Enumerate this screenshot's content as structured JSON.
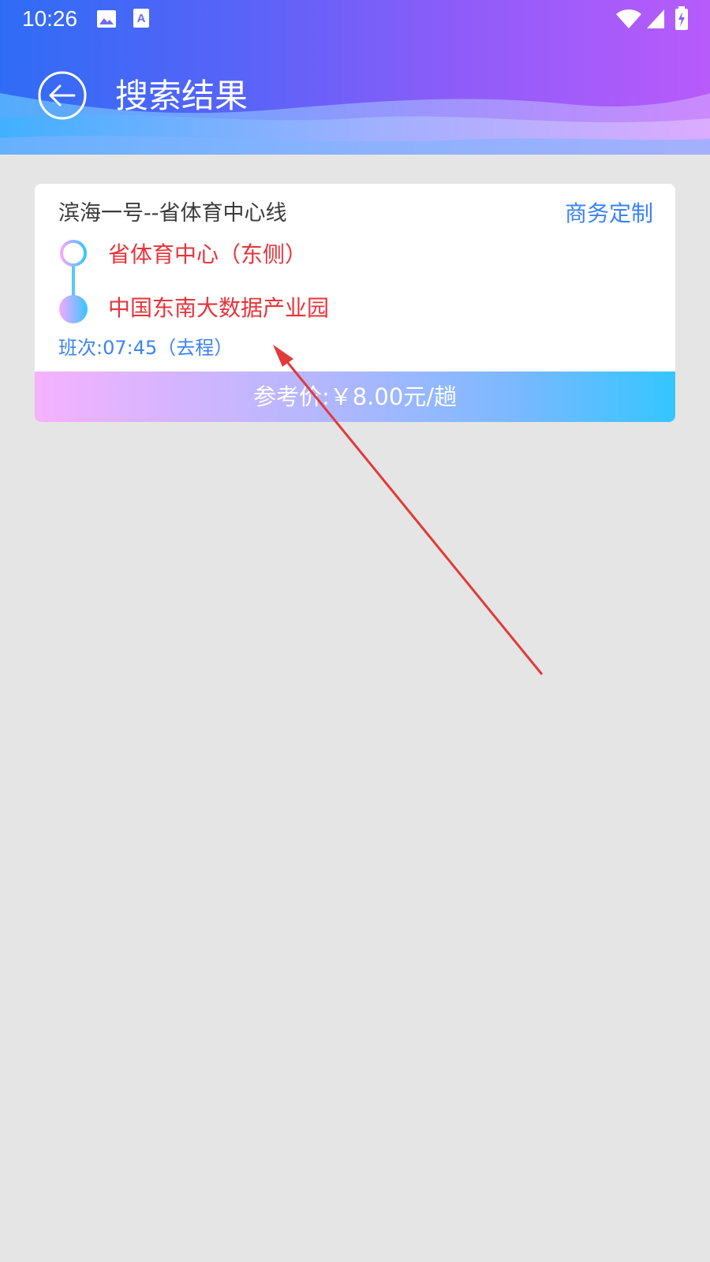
{
  "status_bar": {
    "time": "10:26",
    "icons": [
      "image-icon",
      "font-icon",
      "wifi-icon",
      "signal-icon",
      "battery-charging-icon"
    ]
  },
  "header": {
    "title": "搜索结果",
    "back_icon": "back-arrow-icon"
  },
  "result_card": {
    "route_name": "滨海一号--省体育中心线",
    "service_type": "商务定制",
    "start_stop": "省体育中心（东侧）",
    "end_stop": "中国东南大数据产业园",
    "schedule": "班次:07:45（去程）",
    "price": "参考价:￥8.00元/趟"
  },
  "colors": {
    "accent_blue": "#3b82f6",
    "stop_red": "#e8333a",
    "header_start": "#2f6cf6",
    "header_end": "#b85bfb",
    "annotation_arrow": "#e03a3a"
  }
}
